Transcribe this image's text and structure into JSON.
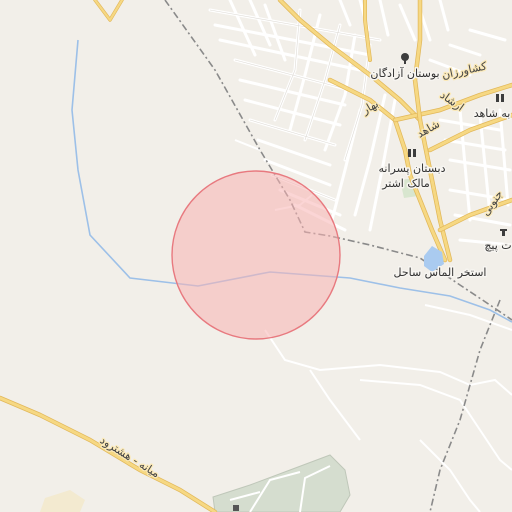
{
  "map": {
    "colors": {
      "background": "#f2efe9",
      "major_road": "#f6d883",
      "major_road_casing": "#e2b85a",
      "minor_road": "#ffffff",
      "minor_road_casing": "#d6d2cb",
      "river": "#9dc0e8",
      "lake": "#aacbf0",
      "railway": "#8a8a8a",
      "highlight_fill": "#f7b3b3",
      "highlight_stroke": "#e8797f",
      "park": "#d8e6cf",
      "cemetery": "#c9d3c4"
    },
    "labels": {
      "park": "بوستان آزادگان",
      "keshavarzan": "کشاورزان",
      "ershad": "ارشاد",
      "shahed": "شاهد",
      "bahar": "بهار",
      "school_line1": "دبستان پسرانه",
      "school_line2": "مالک اشتر",
      "shahed_right": "به شاهد",
      "lake": "استخر الماس ساحل",
      "south_right": "جنوبی",
      "pich": "ت پیچ",
      "road_sw": "میانه - هشترود"
    },
    "icons": [
      "tree-icon",
      "school-icon",
      "school-icon",
      "restaurant-icon",
      "marker-icon"
    ]
  }
}
